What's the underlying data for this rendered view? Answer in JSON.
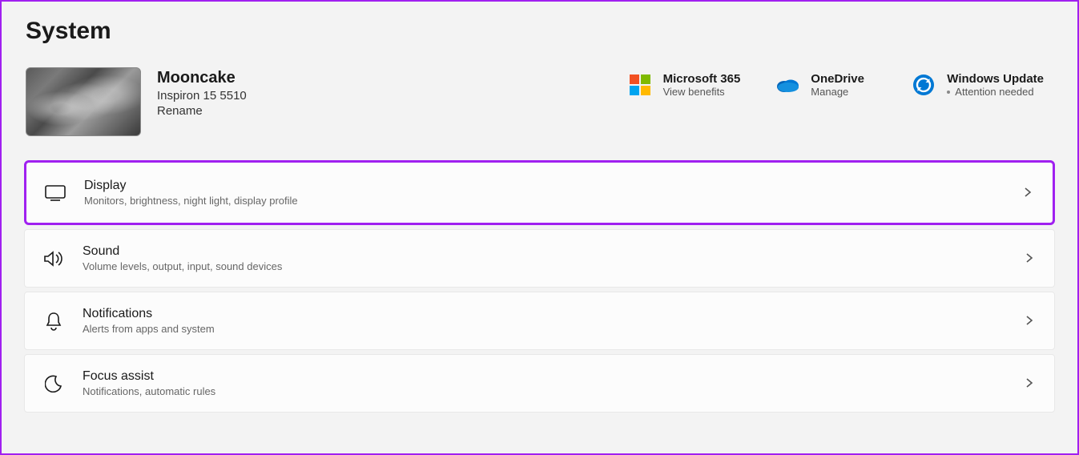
{
  "page_title": "System",
  "device": {
    "name": "Mooncake",
    "model": "Inspiron 15 5510",
    "rename_label": "Rename"
  },
  "quick_cards": {
    "ms365": {
      "title": "Microsoft 365",
      "subtitle": "View benefits"
    },
    "onedrive": {
      "title": "OneDrive",
      "subtitle": "Manage"
    },
    "update": {
      "title": "Windows Update",
      "subtitle": "Attention needed"
    }
  },
  "items": {
    "display": {
      "title": "Display",
      "desc": "Monitors, brightness, night light, display profile"
    },
    "sound": {
      "title": "Sound",
      "desc": "Volume levels, output, input, sound devices"
    },
    "notifications": {
      "title": "Notifications",
      "desc": "Alerts from apps and system"
    },
    "focus": {
      "title": "Focus assist",
      "desc": "Notifications, automatic rules"
    }
  }
}
